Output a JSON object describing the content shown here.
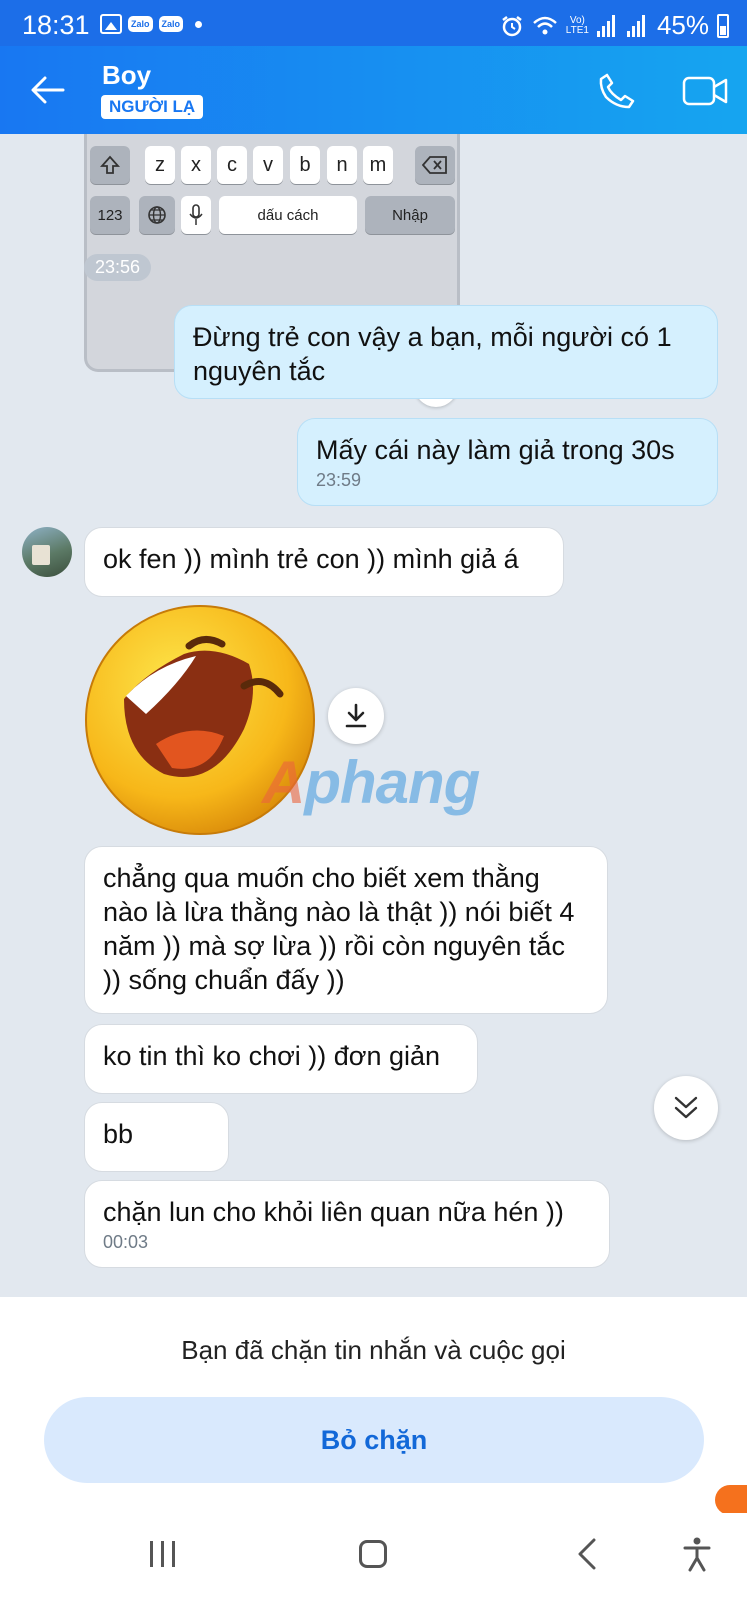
{
  "status_bar": {
    "time": "18:31",
    "zalo1": "Zalo",
    "zalo2": "Zalo",
    "volte": "Vo)",
    "lte": "LTE1",
    "battery": "45%"
  },
  "header": {
    "name": "Boy",
    "badge": "NGƯỜI LẠ"
  },
  "keyboard": {
    "row3": [
      "z",
      "x",
      "c",
      "v",
      "b",
      "n",
      "m"
    ],
    "num_key": "123",
    "space_key": "dấu cách",
    "enter_key": "Nhập"
  },
  "messages": {
    "time_pill": "23:56",
    "out1": "Đừng trẻ con vậy a bạn, mỗi người có 1 nguyên tắc",
    "out2": "Mấy cái này làm giả trong 30s",
    "out2_time": "23:59",
    "in1": "ok fen )) mình trẻ con )) mình giả á",
    "in2": "chẳng qua muốn cho biết xem thằng nào là lừa thằng nào là thật )) nói biết 4 năm )) mà sợ lừa )) rồi còn nguyên tắc )) sống chuẩn đấy ))",
    "in3": "ko tin thì ko chơi )) đơn giản",
    "in4": "bb",
    "in5": "chặn lun cho khỏi liên quan nữa hén ))",
    "in5_time": "00:03"
  },
  "watermark": {
    "first": "A",
    "rest": "phang"
  },
  "blocked": {
    "text": "Bạn đã chặn tin nhắn và cuộc gọi",
    "button": "Bỏ chặn"
  },
  "colors": {
    "header": "#1877f2",
    "accent": "#1268d8",
    "outgoing_bubble": "#d5f0fe"
  }
}
